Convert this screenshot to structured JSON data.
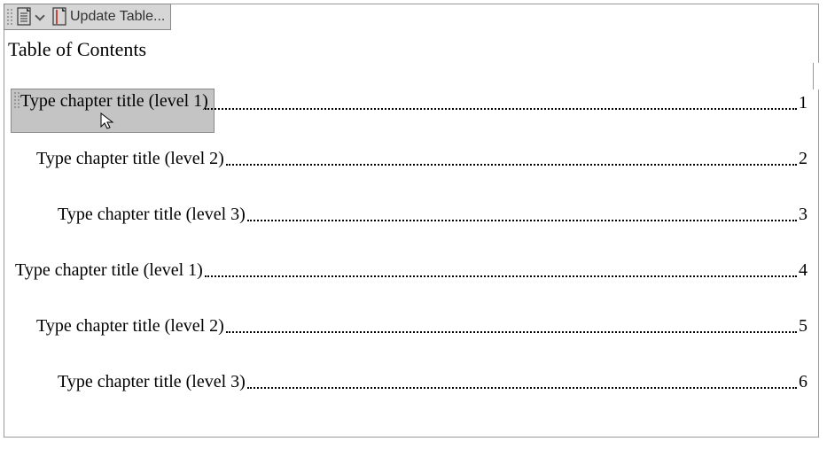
{
  "toolbar": {
    "dropdown_label": "toc-options",
    "update_label": "Update Table..."
  },
  "title": "Table of Contents",
  "entries": [
    {
      "level": 1,
      "text": "Type chapter title (level 1)",
      "page": "1",
      "selected": true
    },
    {
      "level": 2,
      "text": "Type chapter title (level 2)",
      "page": "2",
      "selected": false
    },
    {
      "level": 3,
      "text": "Type chapter title (level 3)",
      "page": "3",
      "selected": false
    },
    {
      "level": 1,
      "text": "Type chapter title (level 1)",
      "page": "4",
      "selected": false
    },
    {
      "level": 2,
      "text": "Type chapter title (level 2)",
      "page": "5",
      "selected": false
    },
    {
      "level": 3,
      "text": "Type chapter title (level 3)",
      "page": "6",
      "selected": false
    }
  ]
}
